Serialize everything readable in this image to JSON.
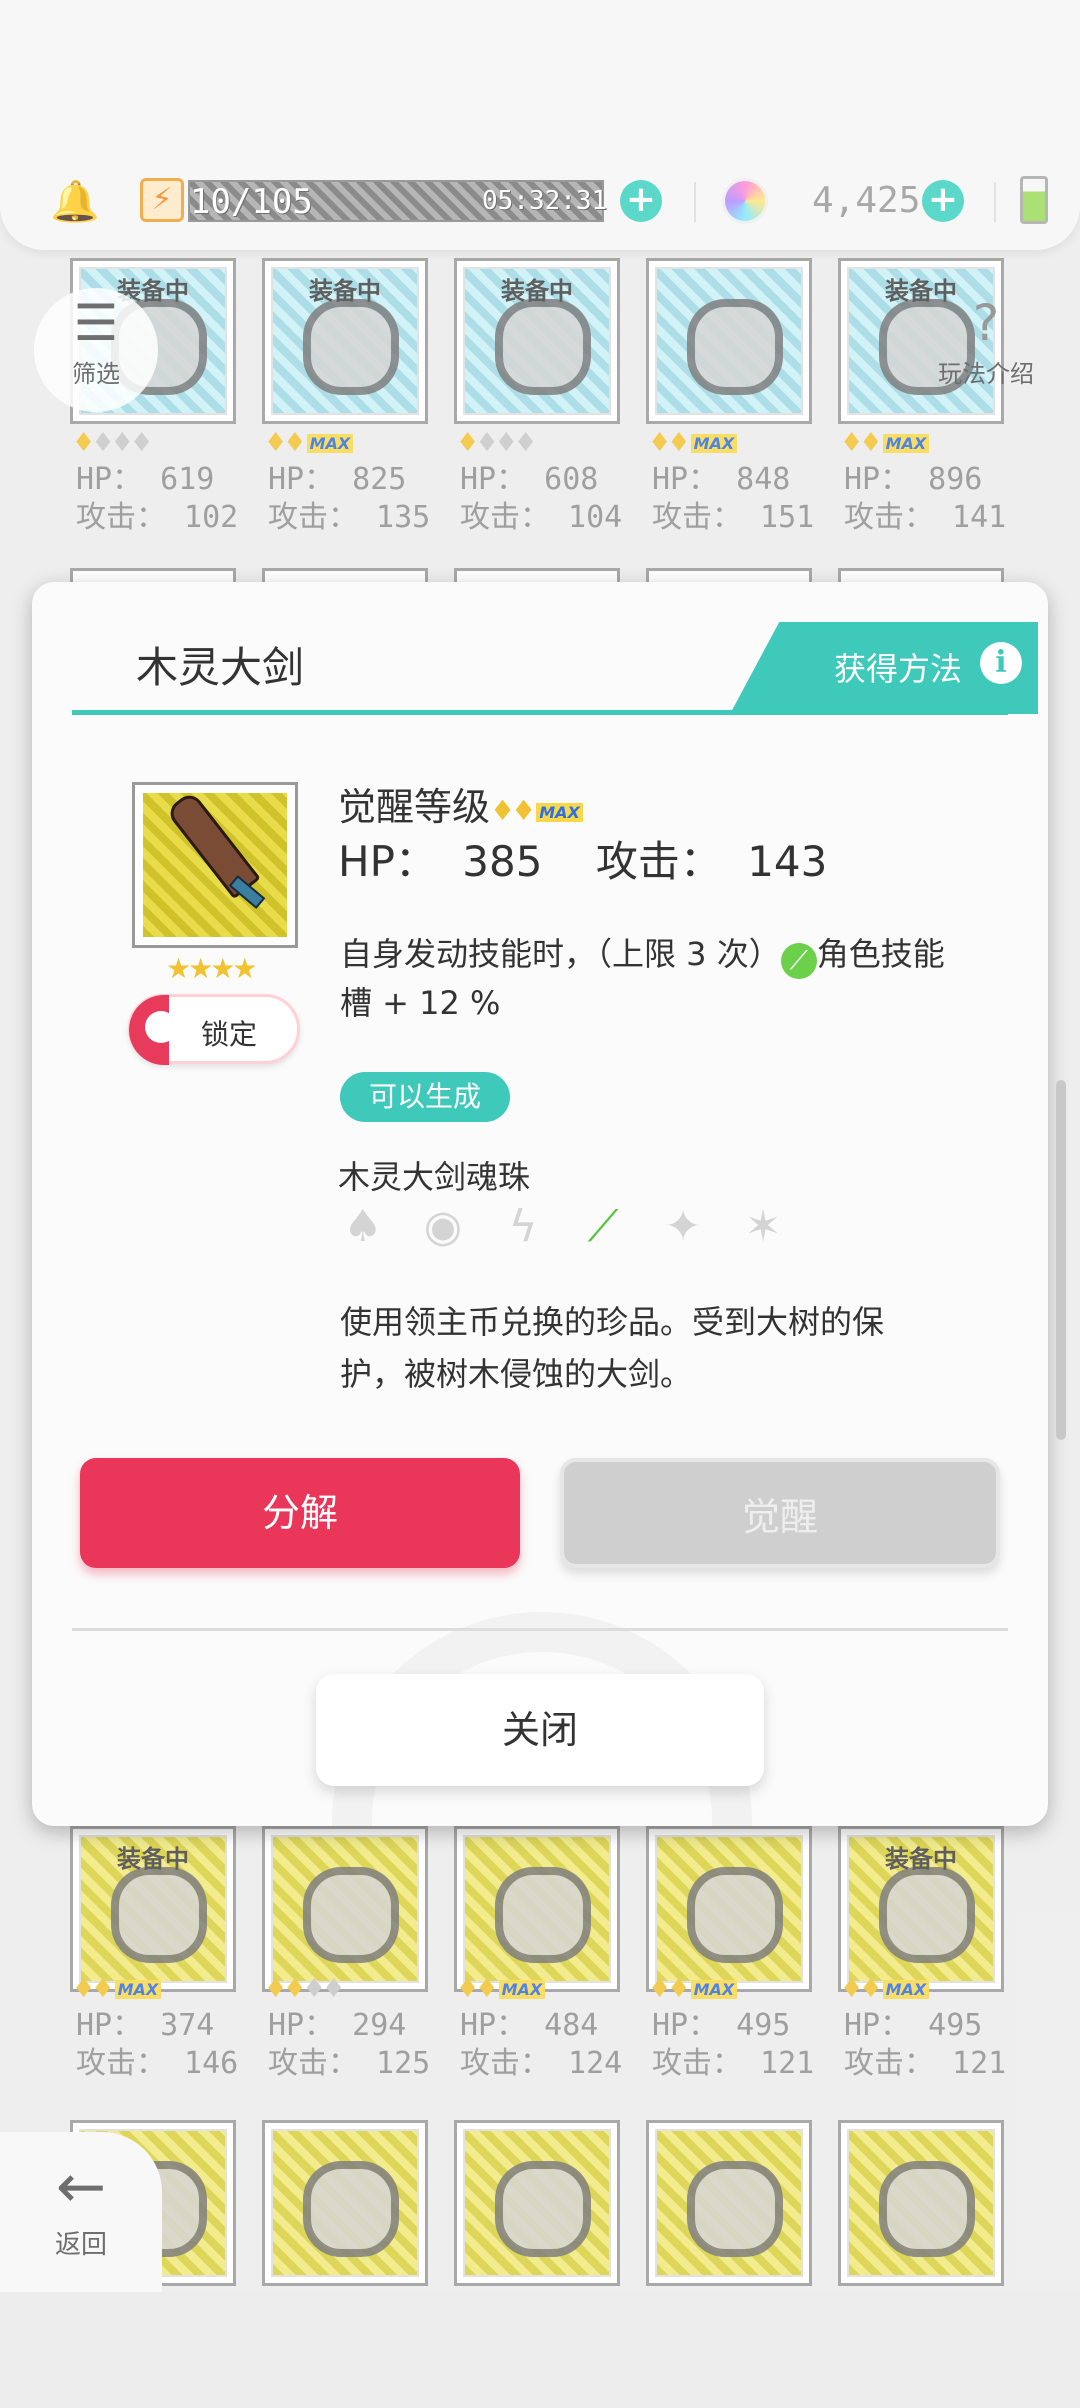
{
  "topbar": {
    "energy": "10/105",
    "timer": "05:32:31",
    "gems": "4,425"
  },
  "side_buttons": {
    "filter_label": "筛选",
    "help_label": "玩法介绍",
    "back_label": "返回"
  },
  "grid_top": [
    {
      "tag": "装备中",
      "hp": "HP： 619",
      "atk": "攻击： 102",
      "filled_stars": 1,
      "max": false,
      "gold": false
    },
    {
      "tag": "装备中",
      "hp": "HP： 825",
      "atk": "攻击： 135",
      "filled_stars": 2,
      "max": true,
      "gold": false
    },
    {
      "tag": "装备中",
      "hp": "HP： 608",
      "atk": "攻击： 104",
      "filled_stars": 1,
      "max": false,
      "gold": false
    },
    {
      "tag": "",
      "hp": "HP： 848",
      "atk": "攻击： 151",
      "filled_stars": 2,
      "max": true,
      "gold": false
    },
    {
      "tag": "装备中",
      "hp": "HP： 896",
      "atk": "攻击： 141",
      "filled_stars": 2,
      "max": true,
      "gold": false
    }
  ],
  "grid_bottom": [
    {
      "tag": "装备中",
      "hp": "HP： 374",
      "atk": "攻击： 146",
      "filled_stars": 2,
      "max": true,
      "gold": true
    },
    {
      "tag": "",
      "hp": "HP： 294",
      "atk": "攻击： 125",
      "filled_stars": 2,
      "max": false,
      "gold": true
    },
    {
      "tag": "",
      "hp": "HP： 484",
      "atk": "攻击： 124",
      "filled_stars": 2,
      "max": true,
      "gold": true
    },
    {
      "tag": "",
      "hp": "HP： 495",
      "atk": "攻击： 121",
      "filled_stars": 2,
      "max": true,
      "gold": true
    },
    {
      "tag": "装备中",
      "hp": "HP： 495",
      "atk": "攻击： 121",
      "filled_stars": 2,
      "max": true,
      "gold": true
    }
  ],
  "modal": {
    "title": "木灵大剑",
    "obtain_label": "获得方法",
    "awaken_level_label": "觉醒等级",
    "max_label": "MAX",
    "hp_label": "HP：",
    "hp_value": "385",
    "atk_label": "攻击：",
    "atk_value": "143",
    "skill_prefix": "自身发动技能时，（上限 3 次）",
    "skill_suffix": "角色技能槽 + 12 %",
    "item_stars": "★★★★",
    "lock_label": "锁定",
    "generate_badge": "可以生成",
    "orb_name": "木灵大剑魂珠",
    "elements": [
      "fire",
      "orb",
      "lightning",
      "leaf",
      "star",
      "shuriken"
    ],
    "active_element": "leaf",
    "description": "使用领主币兑换的珍品。受到大树的保护，被树木侵蚀的大剑。",
    "decompose_label": "分解",
    "awaken_label": "觉醒",
    "close_label": "关闭"
  },
  "colors": {
    "accent": "#3fc9bb",
    "danger": "#ea3658",
    "disabled": "#cfcfcf"
  }
}
